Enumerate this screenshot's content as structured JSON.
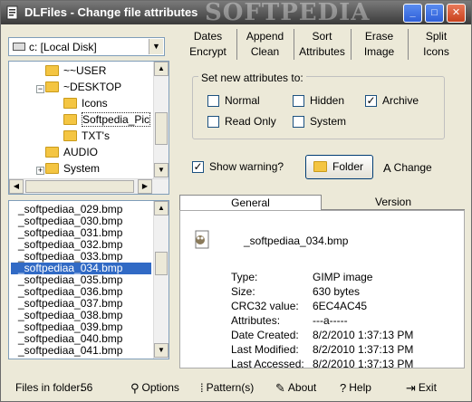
{
  "window": {
    "title": "DLFiles - Change file attributes",
    "watermark": "SOFTPEDIA",
    "controls": {
      "minimize": "_",
      "maximize": "□",
      "close": "✕"
    }
  },
  "drive": {
    "selected": "c: [Local Disk]"
  },
  "tree": {
    "items": [
      {
        "label": "~~USER",
        "expander": ""
      },
      {
        "label": "~DESKTOP",
        "expander": "−"
      },
      {
        "label": "Icons",
        "expander": ""
      },
      {
        "label": "Softpedia_Pic",
        "expander": ""
      },
      {
        "label": "TXT's",
        "expander": ""
      },
      {
        "label": "AUDIO",
        "expander": ""
      },
      {
        "label": "System",
        "expander": "+"
      }
    ]
  },
  "files": {
    "items": [
      "_softpediaa_029.bmp",
      "_softpediaa_030.bmp",
      "_softpediaa_031.bmp",
      "_softpediaa_032.bmp",
      "_softpediaa_033.bmp",
      "_softpediaa_034.bmp",
      "_softpediaa_035.bmp",
      "_softpediaa_036.bmp",
      "_softpediaa_037.bmp",
      "_softpediaa_038.bmp",
      "_softpediaa_039.bmp",
      "_softpediaa_040.bmp",
      "_softpediaa_041.bmp"
    ],
    "selected_index": 5
  },
  "tabs": {
    "row1": [
      "Dates",
      "Append",
      "Sort",
      "Erase",
      "Split"
    ],
    "row2": [
      "Encrypt",
      "Clean",
      "Attributes",
      "Image",
      "Icons"
    ]
  },
  "attributes": {
    "group_title": "Set new attributes to:",
    "normal": "Normal",
    "hidden": "Hidden",
    "archive": "Archive",
    "read_only": "Read Only",
    "system": "System",
    "archive_checked": "✓",
    "show_warning": "Show warning?",
    "show_warning_checked": "✓",
    "folder_button": "Folder",
    "change_button": "Change"
  },
  "info": {
    "tab_general": "General",
    "tab_version": "Version",
    "filename": "_softpediaa_034.bmp",
    "props": [
      {
        "label": "Type:",
        "value": "GIMP image"
      },
      {
        "label": "Size:",
        "value": "630 bytes"
      },
      {
        "label": "CRC32 value:",
        "value": "6EC4AC45"
      },
      {
        "label": "Attributes:",
        "value": "---a-----"
      },
      {
        "label": "Date Created:",
        "value": "8/2/2010 1:37:13 PM"
      },
      {
        "label": "Last Modified:",
        "value": "8/2/2010 1:37:13 PM"
      },
      {
        "label": "Last Accessed:",
        "value": "8/2/2010 1:37:13 PM"
      }
    ]
  },
  "status": {
    "files_label": "Files in folder:",
    "files_count": "56",
    "options": "Options",
    "patterns": "Pattern(s)",
    "about": "About",
    "help": "Help",
    "exit": "Exit"
  }
}
